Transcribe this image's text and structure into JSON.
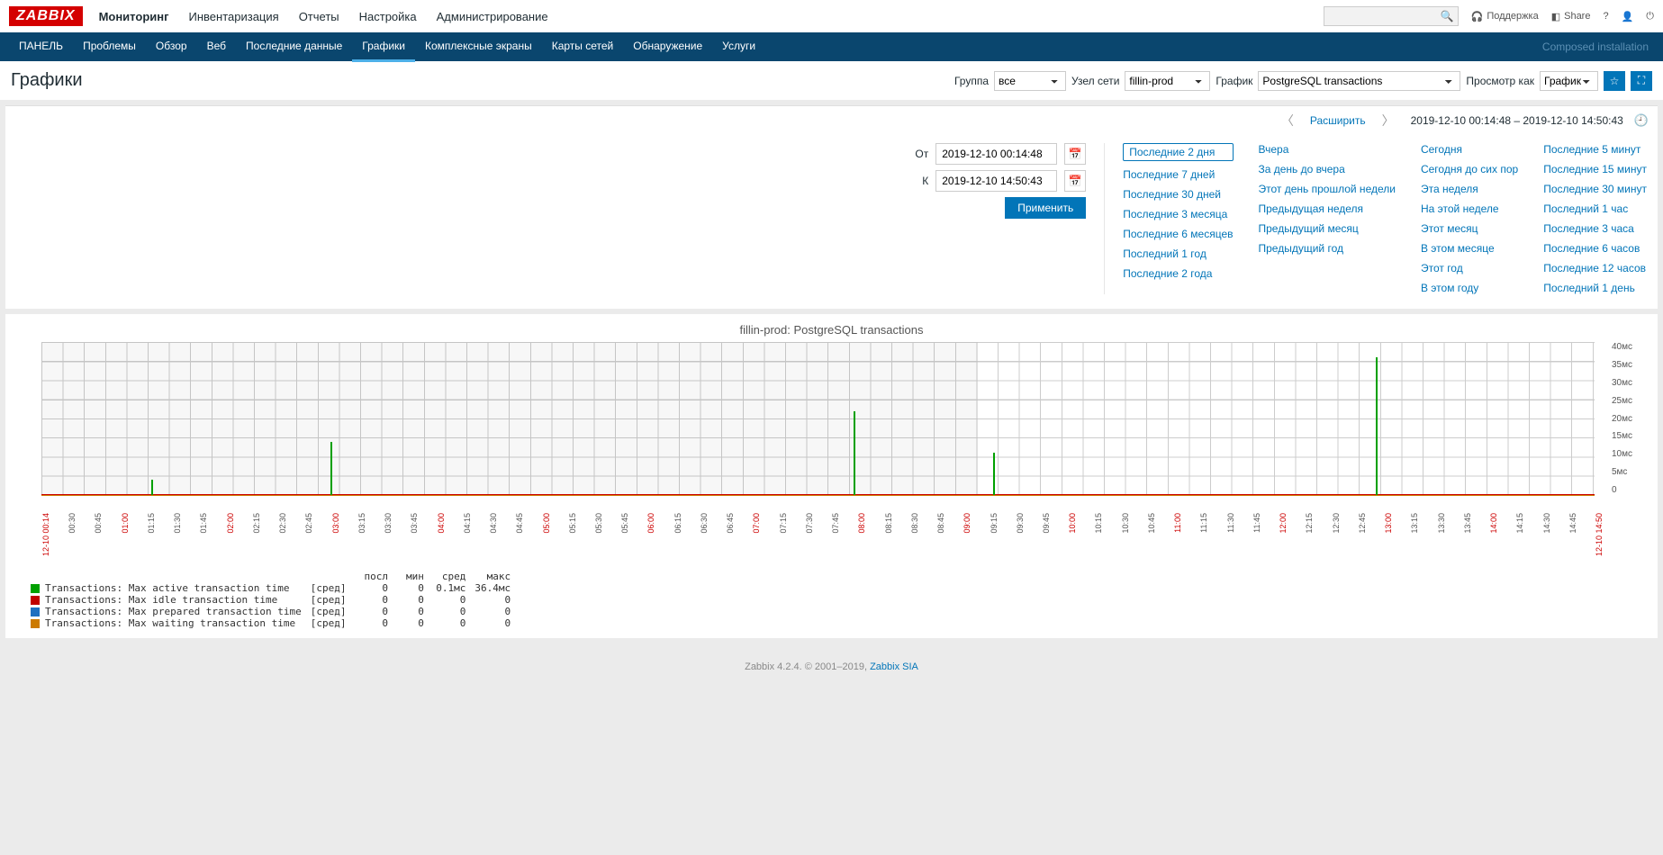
{
  "logo": "ZABBIX",
  "topmenu": [
    "Мониторинг",
    "Инвентаризация",
    "Отчеты",
    "Настройка",
    "Администрирование"
  ],
  "topmenu_active": 0,
  "topright": {
    "support": "Поддержка",
    "share": "Share"
  },
  "nav": [
    "ПАНЕЛЬ",
    "Проблемы",
    "Обзор",
    "Веб",
    "Последние данные",
    "Графики",
    "Комплексные экраны",
    "Карты сетей",
    "Обнаружение",
    "Услуги"
  ],
  "nav_active": 5,
  "nav_right": "Composed installation",
  "page_title": "Графики",
  "filters": {
    "group_label": "Группа",
    "group_value": "все",
    "host_label": "Узел сети",
    "host_value": "fillin-prod",
    "graph_label": "График",
    "graph_value": "PostgreSQL transactions",
    "view_label": "Просмотр как",
    "view_value": "График"
  },
  "expand": {
    "label": "Расширить",
    "range": "2019-12-10 00:14:48 – 2019-12-10 14:50:43"
  },
  "period_form": {
    "from_label": "От",
    "from_value": "2019-12-10 00:14:48",
    "to_label": "К",
    "to_value": "2019-12-10 14:50:43",
    "apply": "Применить"
  },
  "period_cols": [
    [
      "Последние 2 дня",
      "Последние 7 дней",
      "Последние 30 дней",
      "Последние 3 месяца",
      "Последние 6 месяцев",
      "Последний 1 год",
      "Последние 2 года"
    ],
    [
      "Вчера",
      "За день до вчера",
      "Этот день прошлой недели",
      "Предыдущая неделя",
      "Предыдущий месяц",
      "Предыдущий год"
    ],
    [
      "Сегодня",
      "Сегодня до сих пор",
      "Эта неделя",
      "На этой неделе",
      "Этот месяц",
      "В этом месяце",
      "Этот год",
      "В этом году"
    ],
    [
      "Последние 5 минут",
      "Последние 15 минут",
      "Последние 30 минут",
      "Последний 1 час",
      "Последние 3 часа",
      "Последние 6 часов",
      "Последние 12 часов",
      "Последний 1 день"
    ]
  ],
  "period_selected": "Последние 2 дня",
  "chart_data": {
    "type": "line",
    "title": "fillin-prod: PostgreSQL transactions",
    "ylabel": "",
    "yunit": "мс",
    "ylim": [
      0,
      40
    ],
    "yticks": [
      0,
      "5мс",
      "10мс",
      "15мс",
      "20мс",
      "25мс",
      "30мс",
      "35мс",
      "40мс"
    ],
    "x_start": "12-10 00:14",
    "x_end": "12-10 14:50",
    "xticks": [
      "00:30",
      "00:45",
      "01:00",
      "01:15",
      "01:30",
      "01:45",
      "02:00",
      "02:15",
      "02:30",
      "02:45",
      "03:00",
      "03:15",
      "03:30",
      "03:45",
      "04:00",
      "04:15",
      "04:30",
      "04:45",
      "05:00",
      "05:15",
      "05:30",
      "05:45",
      "06:00",
      "06:15",
      "06:30",
      "06:45",
      "07:00",
      "07:15",
      "07:30",
      "07:45",
      "08:00",
      "08:15",
      "08:30",
      "08:45",
      "09:00",
      "09:15",
      "09:30",
      "09:45",
      "10:00",
      "10:15",
      "10:30",
      "10:45",
      "11:00",
      "11:15",
      "11:30",
      "11:45",
      "12:00",
      "12:15",
      "12:30",
      "12:45",
      "13:00",
      "13:15",
      "13:30",
      "13:45",
      "14:00",
      "14:15",
      "14:30",
      "14:45"
    ],
    "hour_marks": [
      "01:00",
      "02:00",
      "03:00",
      "04:00",
      "05:00",
      "06:00",
      "07:00",
      "08:00",
      "09:00",
      "10:00",
      "11:00",
      "12:00",
      "13:00",
      "14:00"
    ],
    "shade_end_pct": 60.3,
    "series": [
      {
        "name": "Transactions: Max active transaction time",
        "agg": "[сред]",
        "color": "#00a000",
        "last": 0,
        "min": 0,
        "avg": "0.1мс",
        "max": "36.4мс",
        "spikes": [
          {
            "t_pct": 7.1,
            "v": 4
          },
          {
            "t_pct": 18.6,
            "v": 14
          },
          {
            "t_pct": 52.3,
            "v": 22
          },
          {
            "t_pct": 61.3,
            "v": 11
          },
          {
            "t_pct": 85.9,
            "v": 36
          }
        ]
      },
      {
        "name": "Transactions: Max idle transaction time",
        "agg": "[сред]",
        "color": "#c00000",
        "last": 0,
        "min": 0,
        "avg": 0,
        "max": 0,
        "spikes": []
      },
      {
        "name": "Transactions: Max prepared transaction time",
        "agg": "[сред]",
        "color": "#2070c0",
        "last": 0,
        "min": 0,
        "avg": 0,
        "max": 0,
        "spikes": []
      },
      {
        "name": "Transactions: Max waiting transaction time",
        "agg": "[сред]",
        "color": "#cc7a00",
        "last": 0,
        "min": 0,
        "avg": 0,
        "max": 0,
        "spikes": []
      }
    ],
    "legend_headers": [
      "посл",
      "мин",
      "сред",
      "макс"
    ]
  },
  "footer": {
    "text": "Zabbix 4.2.4. © 2001–2019, ",
    "link": "Zabbix SIA"
  }
}
